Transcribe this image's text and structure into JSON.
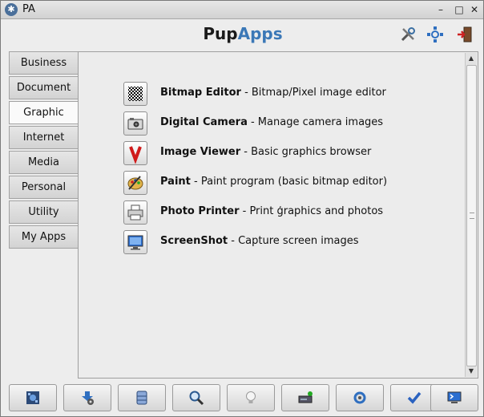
{
  "window": {
    "title": "PA",
    "minimize_glyph": "–",
    "maximize_glyph": "□",
    "close_glyph": "✕"
  },
  "header": {
    "brand_part1": "Pup",
    "brand_part2": "Apps",
    "icons": [
      "tools-icon",
      "network-icon",
      "exit-icon"
    ]
  },
  "tabs": [
    {
      "label": "Business",
      "active": false
    },
    {
      "label": "Document",
      "active": false
    },
    {
      "label": "Graphic",
      "active": true
    },
    {
      "label": "Internet",
      "active": false
    },
    {
      "label": "Media",
      "active": false
    },
    {
      "label": "Personal",
      "active": false
    },
    {
      "label": "Utility",
      "active": false
    },
    {
      "label": "My Apps",
      "active": false
    }
  ],
  "apps": [
    {
      "name": "Bitmap Editor",
      "desc": " - Bitmap/Pixel image editor",
      "icon": "bitmap-editor-icon"
    },
    {
      "name": "Digital Camera",
      "desc": " - Manage camera images",
      "icon": "camera-icon"
    },
    {
      "name": "Image Viewer",
      "desc": " - Basic graphics browser",
      "icon": "image-viewer-icon"
    },
    {
      "name": "Paint",
      "desc": " - Paint program (basic bitmap editor)",
      "icon": "paint-icon"
    },
    {
      "name": "Photo Printer",
      "desc": " - Print ģraphics and photos",
      "icon": "printer-icon"
    },
    {
      "name": "ScreenShot",
      "desc": " - Capture screen images",
      "icon": "screenshot-icon"
    }
  ],
  "bottom_buttons": [
    "puzzle-icon",
    "download-settings-icon",
    "database-icon",
    "search-icon",
    "lightbulb-icon",
    "drive-icon",
    "settings-gear-icon",
    "checkmark-icon",
    "terminal-icon"
  ],
  "colors": {
    "accent": "#3b78b7",
    "window_bg": "#ededed"
  }
}
